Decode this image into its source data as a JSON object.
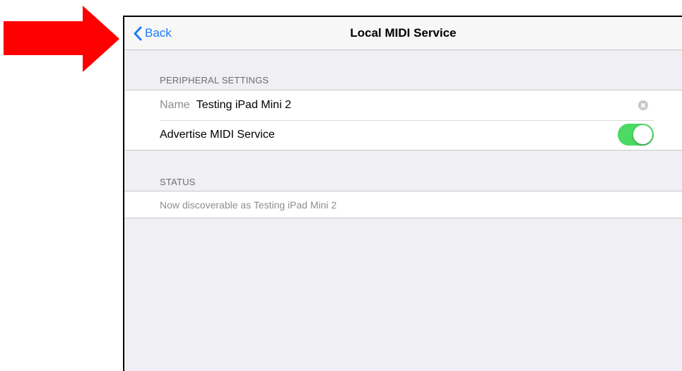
{
  "annotation": {
    "arrow_color": "#ff0000",
    "arrow_icon": "red-arrow-right-icon"
  },
  "navbar": {
    "back_label": "Back",
    "title": "Local MIDI Service",
    "accent_color": "#1a7cf5"
  },
  "peripheral_settings": {
    "header": "PERIPHERAL SETTINGS",
    "name_label": "Name",
    "name_value": "Testing iPad Mini 2",
    "advertise_label": "Advertise MIDI Service",
    "advertise_enabled": true,
    "toggle_color": "#4cd964"
  },
  "status": {
    "header": "STATUS",
    "text": "Now discoverable as Testing iPad Mini 2"
  }
}
